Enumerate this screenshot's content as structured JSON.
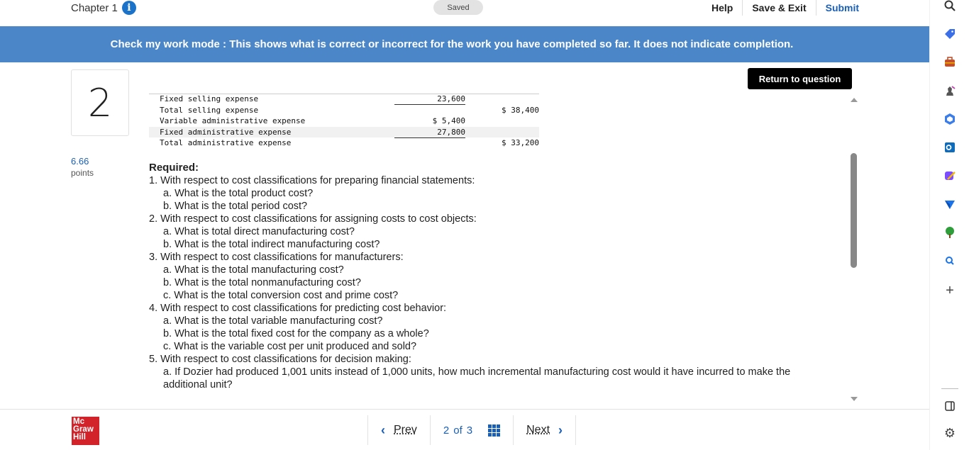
{
  "header": {
    "chapter_label": "Chapter 1",
    "info_icon_glyph": "i",
    "saved_status": "Saved",
    "help_label": "Help",
    "save_exit_label": "Save & Exit",
    "submit_label": "Submit"
  },
  "banner": {
    "text": "Check my work mode : This shows what is correct or incorrect for the work you have completed so far. It does not indicate completion."
  },
  "question": {
    "number": "2",
    "points_value": "6.66",
    "points_label": "points",
    "return_label": "Return to question"
  },
  "table": {
    "rows": [
      {
        "label": "Fixed selling expense",
        "col1": "23,600",
        "col2": ""
      },
      {
        "label": "Total selling expense",
        "col1": "",
        "col2": "$ 38,400"
      },
      {
        "label": "Variable administrative expense",
        "col1": "$ 5,400",
        "col2": ""
      },
      {
        "label": "Fixed administrative expense",
        "col1": "27,800",
        "col2": ""
      },
      {
        "label": "Total administrative expense",
        "col1": "",
        "col2": "$ 33,200"
      }
    ]
  },
  "required": {
    "heading": "Required:",
    "lines": [
      "1. With respect to cost classifications for preparing financial statements:",
      "a. What is the total product cost?",
      "b. What is the total period cost?",
      "2. With respect to cost classifications for assigning costs to cost objects:",
      "a. What is total direct manufacturing cost?",
      "b. What is the total indirect manufacturing cost?",
      "3. With respect to cost classifications for manufacturers:",
      "a. What is the total manufacturing cost?",
      "b. What is the total nonmanufacturing cost?",
      "c. What is the total conversion cost and prime cost?",
      "4. With respect to cost classifications for predicting cost behavior:",
      "a. What is the total variable manufacturing cost?",
      "b. What is the total fixed cost for the company as a whole?",
      "c. What is the variable cost per unit produced and sold?",
      "5. With respect to cost classifications for decision making:",
      "a. If Dozier had produced 1,001 units instead of 1,000 units, how much incremental manufacturing cost would it have incurred to make the additional unit?"
    ]
  },
  "footer": {
    "logo_line1": "Mc",
    "logo_line2": "Graw",
    "logo_line3": "Hill",
    "prev_chevron": "‹",
    "prev_label": "Prev",
    "page_current": "2",
    "page_of": "of",
    "page_total": "3",
    "next_label": "Next",
    "next_chevron": "›"
  },
  "browser_sidebar": {
    "icons": [
      "search-icon",
      "tag-icon",
      "briefcase-icon",
      "chess-icon",
      "copilot-icon",
      "outlook-icon",
      "designer-icon",
      "send-icon",
      "tree-icon",
      "search-small-icon",
      "add-icon",
      "panel-icon",
      "settings-icon"
    ],
    "add_glyph": "+",
    "settings_glyph": "⚙"
  },
  "colors": {
    "banner_bg": "#4a86c8",
    "accent_blue": "#1a5fb4",
    "logo_red": "#d2232a",
    "return_button_bg": "#000000"
  }
}
